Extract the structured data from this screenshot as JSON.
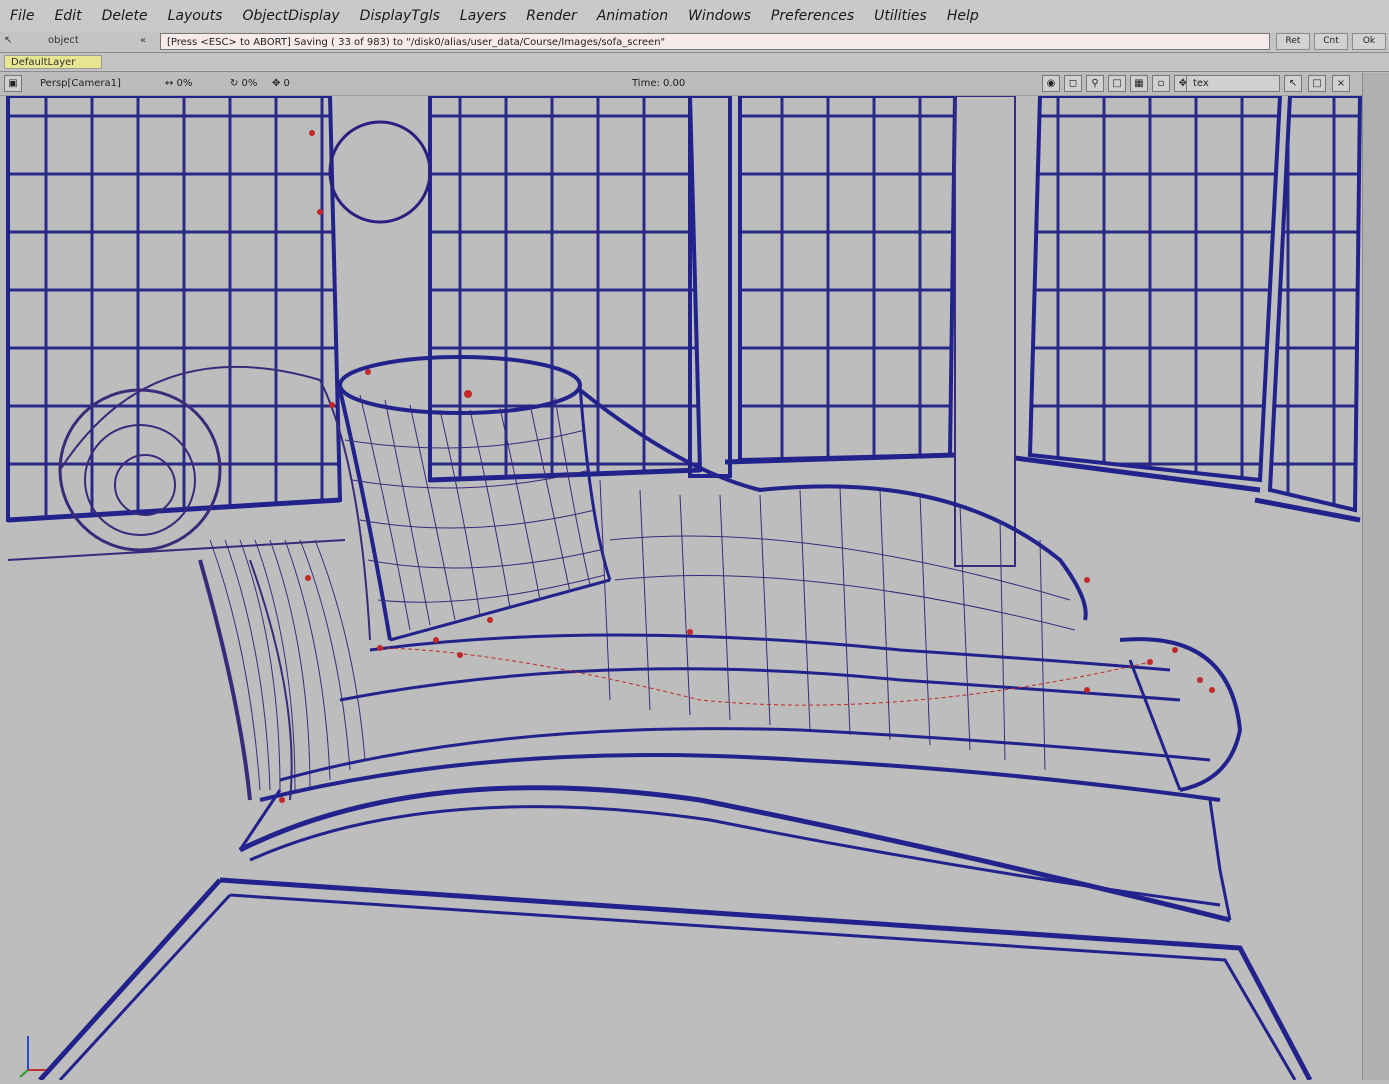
{
  "menu": [
    "File",
    "Edit",
    "Delete",
    "Layouts",
    "ObjectDisplay",
    "DisplayTgls",
    "Layers",
    "Render",
    "Animation",
    "Windows",
    "Preferences",
    "Utilities",
    "Help"
  ],
  "command_row": {
    "left_label": "object",
    "field_text": "[Press <ESC> to ABORT]   Saving ( 33 of 983) to \"/disk0/alias/user_data/Course/Images/sofa_screen\"",
    "buttons": [
      "Ret",
      "Cnt",
      "Ok"
    ]
  },
  "layer": {
    "tab_label": "DefaultLayer"
  },
  "viewport_header": {
    "camera": "Persp[Camera1]",
    "zoom_readout": "↔ 0%",
    "tumble_readout": "↻ 0%",
    "track_readout": "✥ 0",
    "time": "Time: 0.00",
    "mode": "tex"
  },
  "colors": {
    "wire_blue": "#23239a",
    "wire_purple": "#3a2a7a",
    "cv_red": "#c0282a",
    "viewport_bg": "#bdbdbd"
  }
}
